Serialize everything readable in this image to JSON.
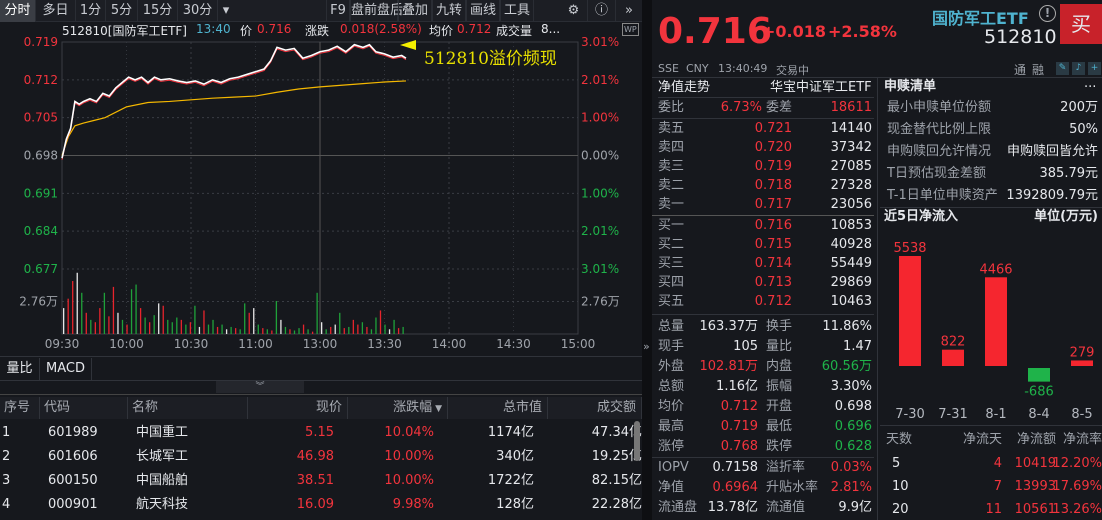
{
  "toolbar": {
    "periods": [
      "分时",
      "多日",
      "1分",
      "5分",
      "15分",
      "30分"
    ],
    "more": "▾",
    "tools": [
      "F9",
      "盘前盘后",
      "叠加",
      "九转",
      "画线",
      "工具"
    ],
    "settings_icon": "gear-icon",
    "help_icon": "help-icon",
    "expand_icon": "double-chevron-right-icon"
  },
  "chart_header": {
    "symbol": "512810[国防军工ETF]",
    "time": "13:40",
    "price_label": "价",
    "price": "0.716",
    "change_label": "涨跌",
    "change": "0.018(2.58%)",
    "avg_label": "均价",
    "avg": "0.712",
    "volume_label": "成交量",
    "volume": "8..."
  },
  "wp_badge": "WP",
  "annotation": "512810溢价频现",
  "chart_data": {
    "type": "line",
    "title": "512810[国防军工ETF] 分时",
    "prev_close": 0.698,
    "ylim": [
      0.677,
      0.719
    ],
    "y_ticks_left": [
      "0.719",
      "0.712",
      "0.705",
      "0.698",
      "0.691",
      "0.684",
      "0.677"
    ],
    "y_ticks_right": [
      "3.01%",
      "2.01%",
      "1.00%",
      "0.00%",
      "1.00%",
      "2.01%",
      "3.01%"
    ],
    "volume_tick": "2.76万",
    "volume_tick_value": 27600,
    "x_ticks": [
      "09:30",
      "10:00",
      "10:30",
      "11:00",
      "13:00",
      "13:30",
      "14:00",
      "14:30",
      "15:00"
    ],
    "total_minutes": 240,
    "price_minutes": [
      0,
      2,
      4,
      6,
      8,
      10,
      13,
      16,
      19,
      22,
      25,
      28,
      31,
      34,
      37,
      40,
      43,
      46,
      50,
      54,
      58,
      62,
      66,
      70,
      74,
      78,
      82,
      86,
      90,
      94,
      97,
      100,
      104,
      108,
      112,
      116,
      120,
      124,
      128,
      132,
      136,
      140,
      143,
      146,
      150,
      154,
      158,
      160
    ],
    "price": [
      0.6975,
      0.701,
      0.703,
      0.708,
      0.7075,
      0.708,
      0.7085,
      0.708,
      0.7095,
      0.709,
      0.7105,
      0.7115,
      0.7125,
      0.712,
      0.7125,
      0.7115,
      0.7125,
      0.712,
      0.7122,
      0.7118,
      0.7115,
      0.7118,
      0.7112,
      0.712,
      0.7115,
      0.7122,
      0.7125,
      0.713,
      0.7135,
      0.714,
      0.7155,
      0.718,
      0.7175,
      0.7178,
      0.716,
      0.7165,
      0.7172,
      0.7175,
      0.7182,
      0.7172,
      0.7185,
      0.718,
      0.7185,
      0.7172,
      0.7168,
      0.7162,
      0.7165,
      0.716
    ],
    "avg_minutes": [
      0,
      3,
      6,
      10,
      15,
      20,
      30,
      40,
      50,
      60,
      70,
      80,
      90,
      100,
      110,
      120,
      130,
      140,
      150,
      160
    ],
    "avg": [
      0.698,
      0.7015,
      0.7035,
      0.704,
      0.7045,
      0.705,
      0.707,
      0.7078,
      0.708,
      0.7083,
      0.7086,
      0.7088,
      0.709,
      0.7097,
      0.7103,
      0.7107,
      0.711,
      0.7113,
      0.7116,
      0.7118
    ],
    "volume": [
      22,
      30,
      45,
      52,
      35,
      18,
      12,
      10,
      22,
      35,
      15,
      40,
      18,
      12,
      8,
      38,
      42,
      22,
      14,
      10,
      16,
      26,
      24,
      12,
      10,
      14,
      12,
      8,
      10,
      24,
      6,
      20,
      8,
      12,
      6,
      8,
      4,
      6,
      5,
      4,
      26,
      18,
      22,
      8,
      5,
      4,
      3,
      28,
      12,
      6,
      4,
      3,
      5,
      8,
      4,
      2,
      35,
      10,
      4,
      6,
      8,
      18,
      5,
      6,
      12,
      8,
      10,
      6,
      4,
      14,
      20,
      8,
      4,
      12,
      5,
      6
    ],
    "volume_up": [
      1,
      1,
      1,
      1,
      0,
      1,
      0,
      1,
      1,
      0,
      1,
      1,
      1,
      0,
      1,
      0,
      0,
      1,
      0,
      1,
      0,
      1,
      1,
      0,
      0,
      0,
      1,
      0,
      1,
      0,
      1,
      1,
      0,
      0,
      1,
      0,
      1,
      0,
      1,
      0,
      0,
      1,
      1,
      0,
      1,
      0,
      1,
      0,
      1,
      0,
      1,
      0,
      0,
      1,
      0,
      1,
      0,
      1,
      0,
      1,
      1,
      0,
      1,
      0,
      1,
      1,
      0,
      1,
      0,
      0,
      1,
      0,
      1,
      0,
      1,
      0
    ],
    "colors": {
      "price": "#ffffff",
      "nav": "#f2343d",
      "avg": "#f5b800",
      "up": "#e8242c",
      "down": "#1fa23a"
    }
  },
  "bottom_tabs": [
    "量比",
    "MACD"
  ],
  "collapse_icon": "double-chevron-down-icon",
  "table": {
    "headers": [
      "序号",
      "代码",
      "名称",
      "现价",
      "涨跌幅",
      "总市值",
      "成交额"
    ],
    "sort_icon": "▼",
    "rows": [
      [
        "1",
        "601989",
        "中国重工",
        "5.15",
        "10.04%",
        "1174亿",
        "47.34亿"
      ],
      [
        "2",
        "601606",
        "长城军工",
        "46.98",
        "10.00%",
        "340亿",
        "19.25亿"
      ],
      [
        "3",
        "600150",
        "中国船舶",
        "38.51",
        "10.00%",
        "1722亿",
        "82.15亿"
      ],
      [
        "4",
        "000901",
        "航天科技",
        "16.09",
        "9.98%",
        "128亿",
        "22.28亿"
      ]
    ]
  },
  "quote": {
    "price": "0.716",
    "change": "+0.018",
    "pct": "+2.58%",
    "name": "国防军工ETF",
    "code": "512810",
    "buy_button": "买",
    "info_icon": "!",
    "exchange": "SSE",
    "currency": "CNY",
    "time": "13:40:49",
    "status": "交易中",
    "tags": [
      "通",
      "融"
    ]
  },
  "nav_panel": {
    "title": "净值走势",
    "fund": "华宝中证军工ETF",
    "weibi": {
      "label": "委比",
      "value": "6.73%",
      "diff_label": "委差",
      "diff": "18611"
    },
    "asks": [
      [
        "卖五",
        "0.721",
        "14140"
      ],
      [
        "卖四",
        "0.720",
        "37342"
      ],
      [
        "卖三",
        "0.719",
        "27085"
      ],
      [
        "卖二",
        "0.718",
        "27328"
      ],
      [
        "卖一",
        "0.717",
        "23056"
      ]
    ],
    "bids": [
      [
        "买一",
        "0.716",
        "10853"
      ],
      [
        "买二",
        "0.715",
        "40928"
      ],
      [
        "买三",
        "0.714",
        "55449"
      ],
      [
        "买四",
        "0.713",
        "29869"
      ],
      [
        "买五",
        "0.712",
        "10463"
      ]
    ],
    "stats": [
      [
        "总量",
        "163.37万",
        "",
        "换手",
        "11.86%",
        ""
      ],
      [
        "现手",
        "105",
        "",
        "量比",
        "1.47",
        ""
      ],
      [
        "外盘",
        "102.81万",
        "red",
        "内盘",
        "60.56万",
        "green"
      ],
      [
        "总额",
        "1.16亿",
        "",
        "振幅",
        "3.30%",
        ""
      ],
      [
        "均价",
        "0.712",
        "red",
        "开盘",
        "0.698",
        ""
      ],
      [
        "最高",
        "0.719",
        "red",
        "最低",
        "0.696",
        "green"
      ],
      [
        "涨停",
        "0.768",
        "red",
        "跌停",
        "0.628",
        "green"
      ]
    ],
    "etf": [
      [
        "IOPV",
        "0.7158",
        "",
        "溢折率",
        "0.03%",
        "red"
      ],
      [
        "净值",
        "0.6964",
        "red",
        "升贴水率",
        "2.81%",
        "red"
      ],
      [
        "流通盘",
        "13.78亿",
        "",
        "流通值",
        "9.9亿",
        ""
      ]
    ]
  },
  "creation": {
    "title": "申赎清单",
    "more": "...",
    "rows": [
      [
        "最小申赎单位份额",
        "200万"
      ],
      [
        "现金替代比例上限",
        "50%"
      ],
      [
        "申购赎回允许情况",
        "申购赎回皆允许"
      ],
      [
        "T日预估现金差额",
        "385.79元"
      ],
      [
        "T-1日单位申赎资产",
        "1392809.79元"
      ]
    ]
  },
  "flow": {
    "title": "近5日净流入",
    "unit": "单位(万元)",
    "chart_data": {
      "type": "bar",
      "categories": [
        "7-30",
        "7-31",
        "8-1",
        "8-4",
        "8-5"
      ],
      "values": [
        5538,
        822,
        4466,
        -686,
        279
      ],
      "labels": [
        "5538",
        "822",
        "4466",
        "-686",
        "279"
      ]
    },
    "headers": [
      "天数",
      "净流天",
      "净流额",
      "净流率"
    ],
    "rows": [
      [
        "5",
        "4",
        "10419",
        "12.20%"
      ],
      [
        "10",
        "7",
        "13993",
        "17.69%"
      ],
      [
        "20",
        "11",
        "10561",
        "13.26%"
      ]
    ]
  }
}
